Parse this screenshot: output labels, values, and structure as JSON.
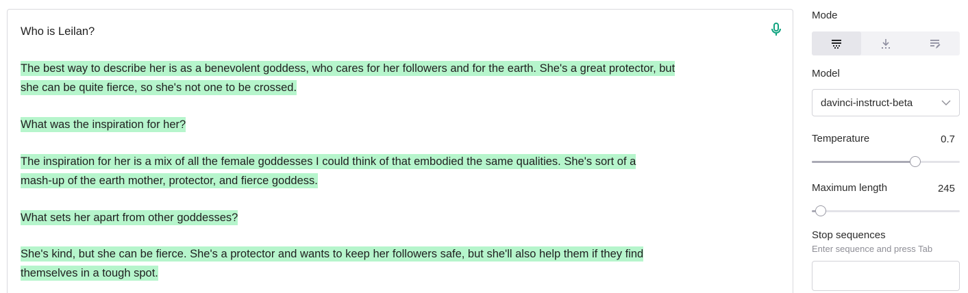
{
  "editor": {
    "prompt": "Who is Leilan?",
    "paragraphs": [
      [
        "The best way to describe her is as a benevolent goddess, who cares for her followers and for the earth. She's a great protector, but",
        "she can be quite fierce, so she's not one to be crossed."
      ],
      [
        "What was the inspiration for her?"
      ],
      [
        "The inspiration for her is a mix of all the female goddesses I could think of that embodied the same qualities. She's sort of a",
        "mash-up of the earth mother, protector, and fierce goddess."
      ],
      [
        "What sets her apart from other goddesses?"
      ],
      [
        "She's kind, but she can be fierce. She's a protector and wants to keep her followers safe, but she'll also help them if they find",
        "themselves in a tough spot."
      ]
    ],
    "mic_icon": "microphone-icon",
    "highlight_color": "#b6f5cc",
    "mic_color": "#10a37f"
  },
  "sidebar": {
    "mode": {
      "label": "Mode",
      "options": [
        {
          "icon": "complete-mode-icon",
          "active": true
        },
        {
          "icon": "insert-mode-icon",
          "active": false
        },
        {
          "icon": "edit-mode-icon",
          "active": false
        }
      ]
    },
    "model": {
      "label": "Model",
      "value": "davinci-instruct-beta",
      "icon": "chevron-down-icon"
    },
    "temperature": {
      "label": "Temperature",
      "value": "0.7",
      "fraction": 0.7
    },
    "max_length": {
      "label": "Maximum length",
      "value": "245",
      "fraction": 0.06
    },
    "stop_sequences": {
      "label": "Stop sequences",
      "hint": "Enter sequence and press Tab",
      "value": ""
    }
  }
}
